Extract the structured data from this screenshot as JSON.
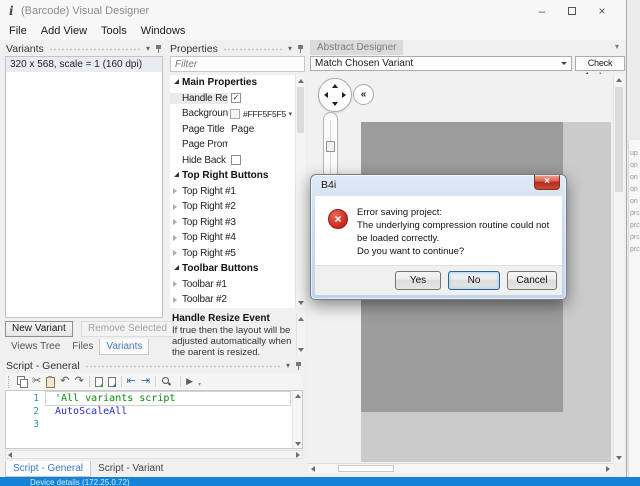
{
  "window": {
    "title": "(Barcode) Visual Designer",
    "logo_glyph": "i",
    "controls": {
      "minimize": "–",
      "close": "×"
    }
  },
  "menu": {
    "items": [
      {
        "label": "File"
      },
      {
        "label": "Add View"
      },
      {
        "label": "Tools"
      },
      {
        "label": "Windows"
      }
    ]
  },
  "variants_panel": {
    "title": "Variants",
    "items": [
      {
        "label": "320 x 568, scale = 1 (160 dpi)",
        "selected": true
      }
    ],
    "buttons": {
      "new_variant": "New Variant",
      "remove_selected": "Remove Selected"
    },
    "tabs": [
      {
        "label": "Views Tree"
      },
      {
        "label": "Files"
      },
      {
        "label": "Variants",
        "active": true
      }
    ]
  },
  "properties_panel": {
    "title": "Properties",
    "filter_placeholder": "Filter",
    "rows": [
      {
        "kind": "section",
        "label": "Main Properties"
      },
      {
        "kind": "checkbox",
        "label": "Handle Resi...",
        "checked": true
      },
      {
        "kind": "color",
        "label": "Background...",
        "value": "#FFF5F5F5",
        "swatch": "#F5F5F5"
      },
      {
        "kind": "text",
        "label": "Page Title",
        "value": "Page"
      },
      {
        "kind": "text",
        "label": "Page Prompt",
        "value": ""
      },
      {
        "kind": "checkbox",
        "label": "Hide Back B...",
        "checked": false
      },
      {
        "kind": "section",
        "label": "Top Right Buttons"
      },
      {
        "kind": "group",
        "label": "Top Right #1"
      },
      {
        "kind": "group",
        "label": "Top Right #2"
      },
      {
        "kind": "group",
        "label": "Top Right #3"
      },
      {
        "kind": "group",
        "label": "Top Right #4"
      },
      {
        "kind": "group",
        "label": "Top Right #5"
      },
      {
        "kind": "section",
        "label": "Toolbar Buttons"
      },
      {
        "kind": "group",
        "label": "Toolbar #1"
      },
      {
        "kind": "group",
        "label": "Toolbar #2"
      }
    ],
    "description": {
      "title": "Handle Resize Event",
      "body": "If true then the layout will be adjusted automatically when the parent is resized."
    }
  },
  "designer_panel": {
    "tab_label": "Abstract Designer",
    "variant_selector_value": "Match Chosen Variant",
    "check_anchors_button": "Check Anchors"
  },
  "script_panel": {
    "title": "Script - General",
    "toolbar_icon_names": [
      "copy-icon",
      "cut-icon",
      "paste-icon",
      "undo-icon",
      "redo-icon",
      "comment-icon",
      "uncomment-icon",
      "outdent-icon",
      "indent-icon",
      "find-icon",
      "run-icon"
    ],
    "code_lines": [
      {
        "num": "1",
        "text": "'All variants script",
        "kind": "comment"
      },
      {
        "num": "2",
        "text": "AutoScaleAll",
        "kind": "keyword"
      },
      {
        "num": "3",
        "text": "",
        "kind": "plain"
      }
    ],
    "tabs": [
      {
        "label": "Script - General",
        "active": true
      },
      {
        "label": "Script - Variant"
      }
    ]
  },
  "error_dialog": {
    "title": "B4i",
    "message_lines": [
      "Error saving project:",
      "The underlying compression routine could not be loaded correctly.",
      "Do you want to continue?"
    ],
    "buttons": [
      {
        "label": "Yes"
      },
      {
        "label": "No",
        "focused": true
      },
      {
        "label": "Cancel"
      }
    ]
  },
  "status_bar": {
    "text": "Device details (172.25.0.72)"
  },
  "edge_fragments": [
    "up",
    "on",
    "on",
    "on",
    "on",
    "prc",
    "prc",
    "prc",
    "prc"
  ],
  "icons": {
    "chevron_down": "▾",
    "double_chevron_left": "«",
    "check": "✓",
    "scissors": "✂",
    "undo": "↶",
    "redo": "↷",
    "outdent": "⇤",
    "indent": "⇥",
    "run": "▶",
    "error_x": "×"
  },
  "colors": {
    "accent_blue": "#3F7BBE",
    "status_bar_blue": "#1283D6",
    "background_property_value": "#FFF5F5F5",
    "comment_green": "#0A8A0A",
    "keyword_blue": "#2929C8",
    "error_red": "#C7271A"
  }
}
